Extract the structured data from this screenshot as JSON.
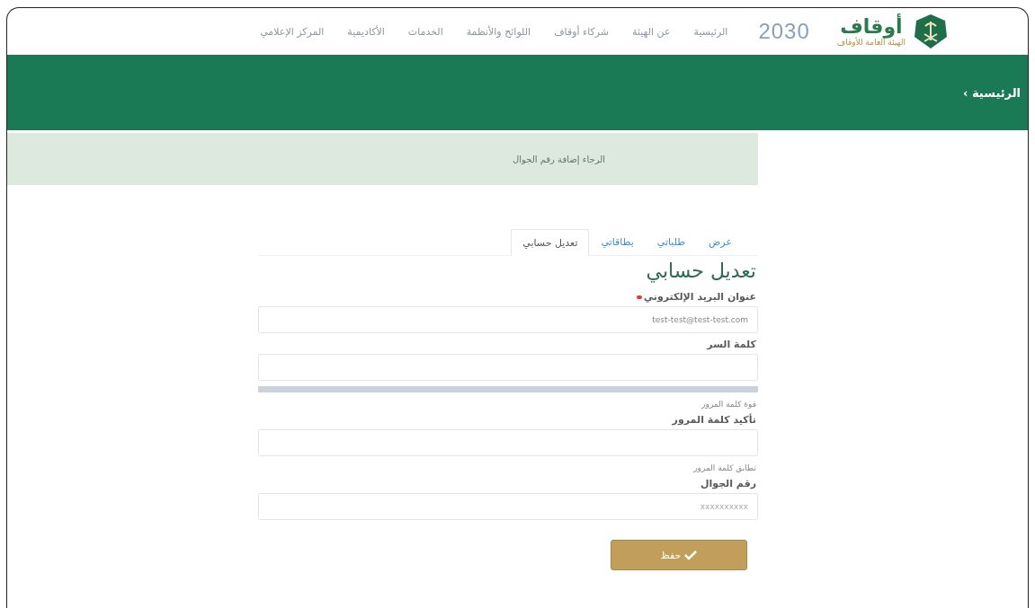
{
  "header": {
    "logo": {
      "title": "أوقاف",
      "subtitle": "الهيئة العامة للأوقاف"
    },
    "vision": {
      "text": "2030"
    },
    "nav": [
      {
        "label": "الرئيسية"
      },
      {
        "label": "عن الهيئة"
      },
      {
        "label": "شركاء أوقاف"
      },
      {
        "label": "اللوائح والأنظمة"
      },
      {
        "label": "الخدمات"
      },
      {
        "label": "الأكاديمية"
      },
      {
        "label": "المركز الإعلامي"
      }
    ]
  },
  "breadcrumb": {
    "label": "الرئيسية",
    "separator": "›"
  },
  "alert": {
    "text": "الرجاء إضافة رقم الجوال"
  },
  "tabs": [
    {
      "label": "عرض",
      "selected": false
    },
    {
      "label": "طلباتي",
      "selected": false
    },
    {
      "label": "بطاقاتي",
      "selected": false
    },
    {
      "label": "تعديل حسابي",
      "selected": true
    }
  ],
  "heading": "تعديل حسابي",
  "fields": [
    {
      "kind": "text",
      "label": "عنوان البريد الإلكتروني",
      "required": true,
      "value": "test-test@test-test.com"
    },
    {
      "kind": "password",
      "label": "كلمة السر",
      "required": false,
      "meter": true,
      "hint": "قوة كلمة المرور"
    },
    {
      "kind": "password",
      "label": "تأكيد كلمة المرور",
      "required": false,
      "hint": "تطابق كلمة المرور"
    },
    {
      "kind": "text",
      "label": "رقم الجوال",
      "required": false,
      "placeholder": "xxxxxxxxxx"
    }
  ],
  "save_button": {
    "label": "حفظ"
  }
}
